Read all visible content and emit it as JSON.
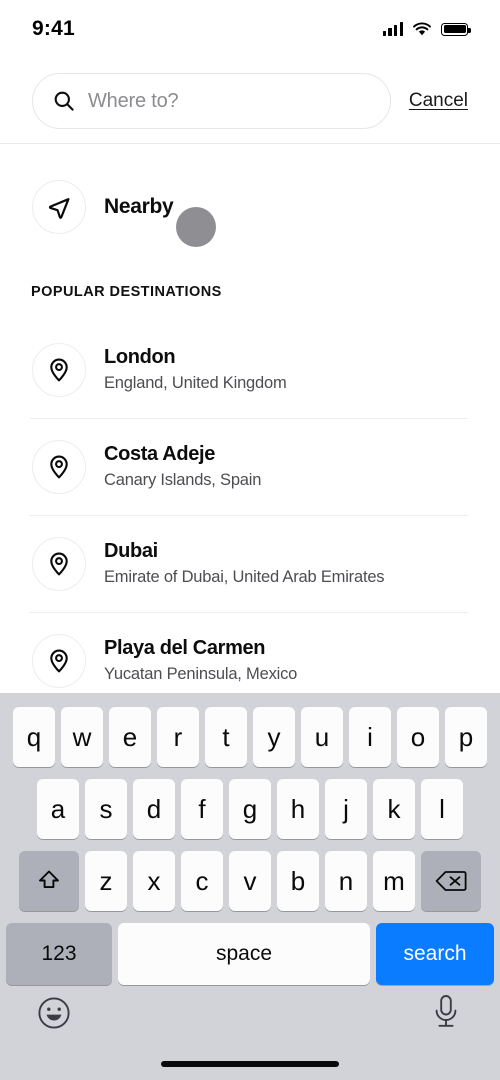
{
  "status_bar": {
    "time": "9:41",
    "icons": {
      "signal": "signal-bars-icon",
      "wifi": "wifi-icon",
      "battery": "battery-full-icon"
    }
  },
  "header": {
    "search": {
      "icon": "search-icon",
      "placeholder": "Where to?",
      "value": ""
    },
    "cancel_label": "Cancel"
  },
  "nearby": {
    "icon": "navigation-arrow-icon",
    "label": "Nearby"
  },
  "section": {
    "title": "POPULAR DESTINATIONS"
  },
  "destinations": [
    {
      "icon": "location-pin-icon",
      "name": "London",
      "subtitle": "England, United Kingdom"
    },
    {
      "icon": "location-pin-icon",
      "name": "Costa Adeje",
      "subtitle": "Canary Islands, Spain"
    },
    {
      "icon": "location-pin-icon",
      "name": "Dubai",
      "subtitle": "Emirate of Dubai, United Arab Emirates"
    },
    {
      "icon": "location-pin-icon",
      "name": "Playa del Carmen",
      "subtitle": "Yucatan Peninsula, Mexico"
    }
  ],
  "keyboard": {
    "row1": [
      "q",
      "w",
      "e",
      "r",
      "t",
      "y",
      "u",
      "i",
      "o",
      "p"
    ],
    "row2": [
      "a",
      "s",
      "d",
      "f",
      "g",
      "h",
      "j",
      "k",
      "l"
    ],
    "row3": [
      "z",
      "x",
      "c",
      "v",
      "b",
      "n",
      "m"
    ],
    "shift_icon": "shift-arrow-icon",
    "backspace_icon": "backspace-delete-icon",
    "numbers_label": "123",
    "space_label": "space",
    "search_label": "search",
    "emoji_icon": "emoji-smiley-icon",
    "mic_icon": "microphone-icon"
  },
  "colors": {
    "accent_blue": "#0a7cff",
    "keyboard_bg": "#d1d3d9",
    "key_bg": "#fcfcfd",
    "mod_key_bg": "#adb0b8",
    "touch_indicator": "#8e8e93",
    "divider": "#ededef"
  }
}
